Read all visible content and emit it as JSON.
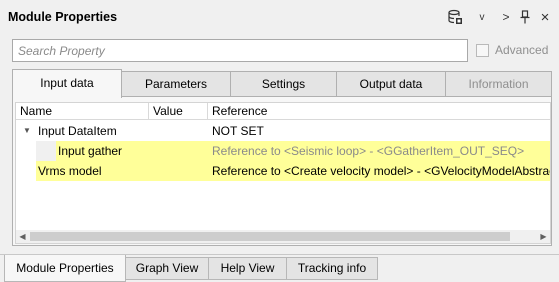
{
  "window": {
    "title": "Module Properties",
    "toolbar": {
      "chevron_down": "v",
      "chevron_right": ">",
      "pin": "⊥",
      "close": "×"
    }
  },
  "search": {
    "placeholder": "Search Property",
    "value": "",
    "advanced_label": "Advanced",
    "advanced_checked": false
  },
  "tabs": [
    {
      "label": "Input data",
      "active": true
    },
    {
      "label": "Parameters",
      "active": false
    },
    {
      "label": "Settings",
      "active": false
    },
    {
      "label": "Output data",
      "active": false
    },
    {
      "label": "Information",
      "active": false,
      "disabled": true
    }
  ],
  "tree": {
    "columns": [
      "Name",
      "Value",
      "Reference"
    ],
    "rows": [
      {
        "name": "Input DataItem",
        "value": "",
        "reference": "NOT SET",
        "expanded": true,
        "level": 0
      },
      {
        "name": "Input gather",
        "value": "",
        "reference": "Reference to <Seismic loop> - <GGatherItem_OUT_SEQ>",
        "level": 1,
        "highlight": true,
        "reference_muted": true
      },
      {
        "name": "Vrms model",
        "value": "",
        "reference": "Reference to <Create velocity model> - <GVelocityModelAbstract",
        "level": 0,
        "highlight": true
      }
    ]
  },
  "bottom_tabs": [
    {
      "label": "Module Properties",
      "active": true
    },
    {
      "label": "Graph View",
      "active": false
    },
    {
      "label": "Help View",
      "active": false
    },
    {
      "label": "Tracking info",
      "active": false
    }
  ],
  "colors": {
    "highlight": "#ffff99",
    "background": "#f0f0f0",
    "muted_text": "#8a8a8a"
  }
}
